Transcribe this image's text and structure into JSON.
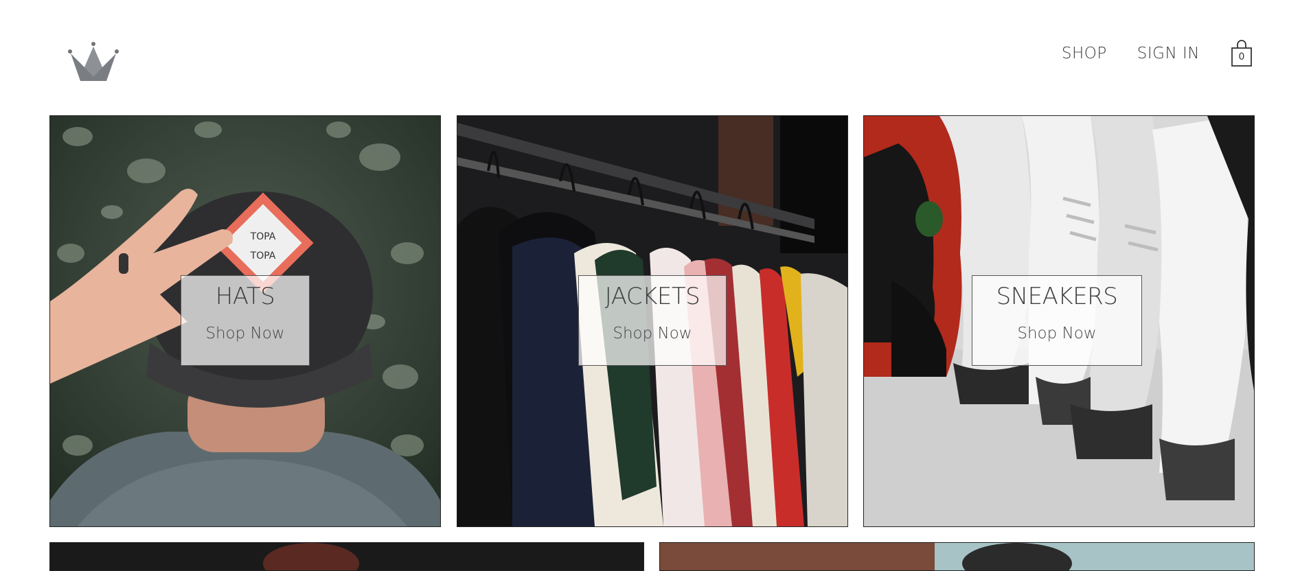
{
  "header": {
    "logo_icon": "crown-icon",
    "nav": {
      "shop_label": "SHOP",
      "sign_in_label": "SIGN IN"
    },
    "cart": {
      "icon": "shopping-bag-icon",
      "count": "0"
    }
  },
  "categories": [
    {
      "title": "HATS",
      "cta": "Shop Now",
      "image": "man-in-black-cap"
    },
    {
      "title": "JACKETS",
      "cta": "Shop Now",
      "image": "jackets-on-rack"
    },
    {
      "title": "SNEAKERS",
      "cta": "Shop Now",
      "image": "sneakers-row"
    }
  ],
  "lower_tiles": [
    {
      "image": "womens-partial"
    },
    {
      "image": "mens-partial"
    }
  ],
  "colors": {
    "text": "#3b3b3b",
    "logo": "#6f7378",
    "label_bg": "rgba(255,255,255,0.72)"
  }
}
